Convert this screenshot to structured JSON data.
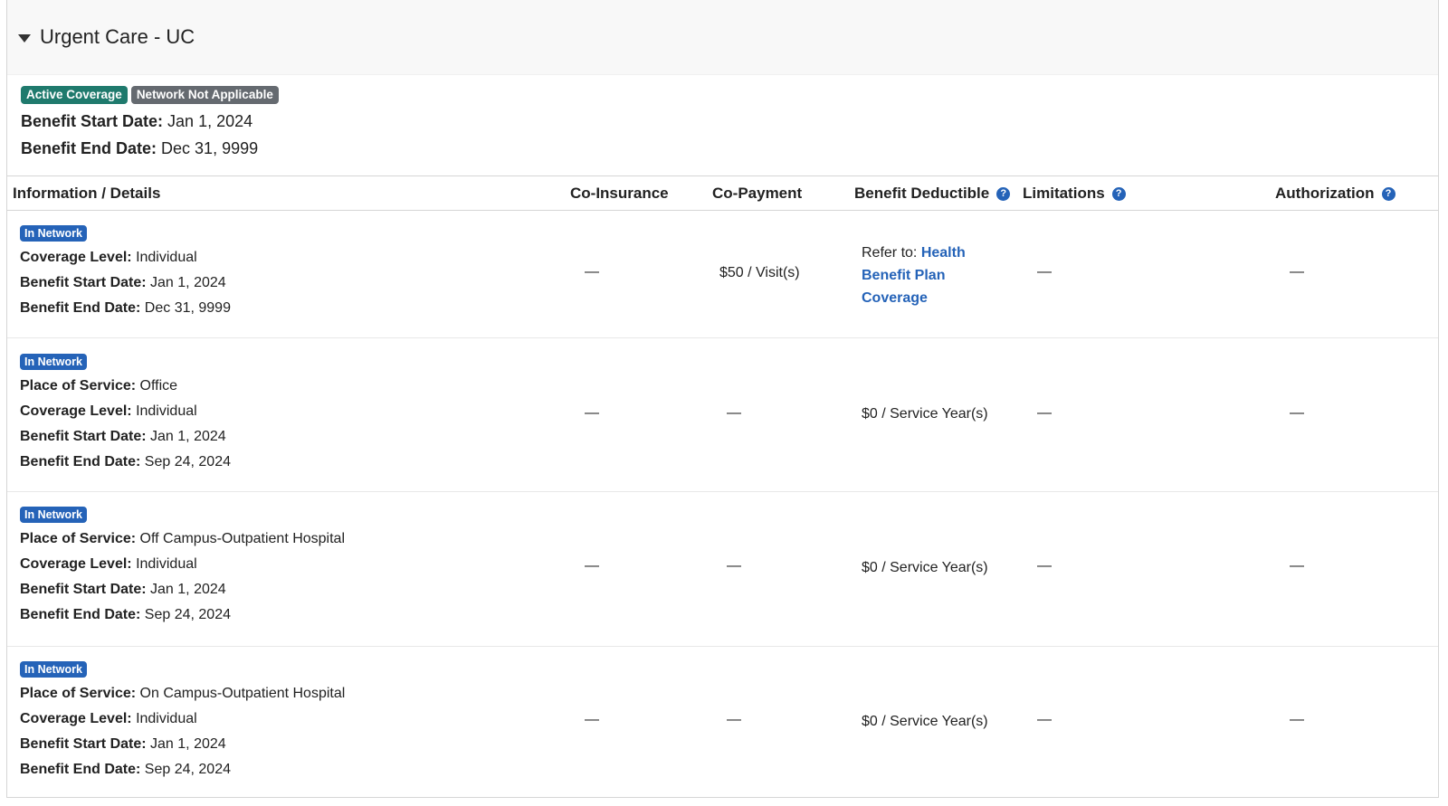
{
  "section": {
    "title": "Urgent Care - UC",
    "badges": {
      "active": "Active Coverage",
      "network": "Network Not Applicable"
    },
    "start_label": "Benefit Start Date:",
    "start_value": "Jan 1, 2024",
    "end_label": "Benefit End Date:",
    "end_value": "Dec 31, 9999"
  },
  "table": {
    "headers": {
      "info": "Information / Details",
      "coins": "Co-Insurance",
      "copay": "Co-Payment",
      "deductible": "Benefit Deductible",
      "limitations": "Limitations",
      "authorization": "Authorization"
    },
    "help_glyph": "?",
    "labels": {
      "place": "Place of Service:",
      "coverage": "Coverage Level:",
      "start": "Benefit Start Date:",
      "end": "Benefit End Date:"
    },
    "rows": [
      {
        "badge": "In Network",
        "coverage": "Individual",
        "start": "Jan 1, 2024",
        "end": "Dec 31, 9999",
        "coins": "—",
        "copay": "$50 / Visit(s)",
        "deductible_prefix": "Refer to:",
        "deductible_link_1": "Health",
        "deductible_link_2": "Benefit Plan",
        "deductible_link_3": "Coverage",
        "limitations": "—",
        "authorization": "—"
      },
      {
        "badge": "In Network",
        "place": "Office",
        "coverage": "Individual",
        "start": "Jan 1, 2024",
        "end": "Sep 24, 2024",
        "coins": "—",
        "copay": "—",
        "deductible": "$0 / Service Year(s)",
        "limitations": "—",
        "authorization": "—"
      },
      {
        "badge": "In Network",
        "place": "Off Campus-Outpatient Hospital",
        "coverage": "Individual",
        "start": "Jan 1, 2024",
        "end": "Sep 24, 2024",
        "coins": "—",
        "copay": "—",
        "deductible": "$0 / Service Year(s)",
        "limitations": "—",
        "authorization": "—"
      },
      {
        "badge": "In Network",
        "place": "On Campus-Outpatient Hospital",
        "coverage": "Individual",
        "start": "Jan 1, 2024",
        "end": "Sep 24, 2024",
        "coins": "—",
        "copay": "—",
        "deductible": "$0 / Service Year(s)",
        "limitations": "—",
        "authorization": "—"
      }
    ]
  }
}
